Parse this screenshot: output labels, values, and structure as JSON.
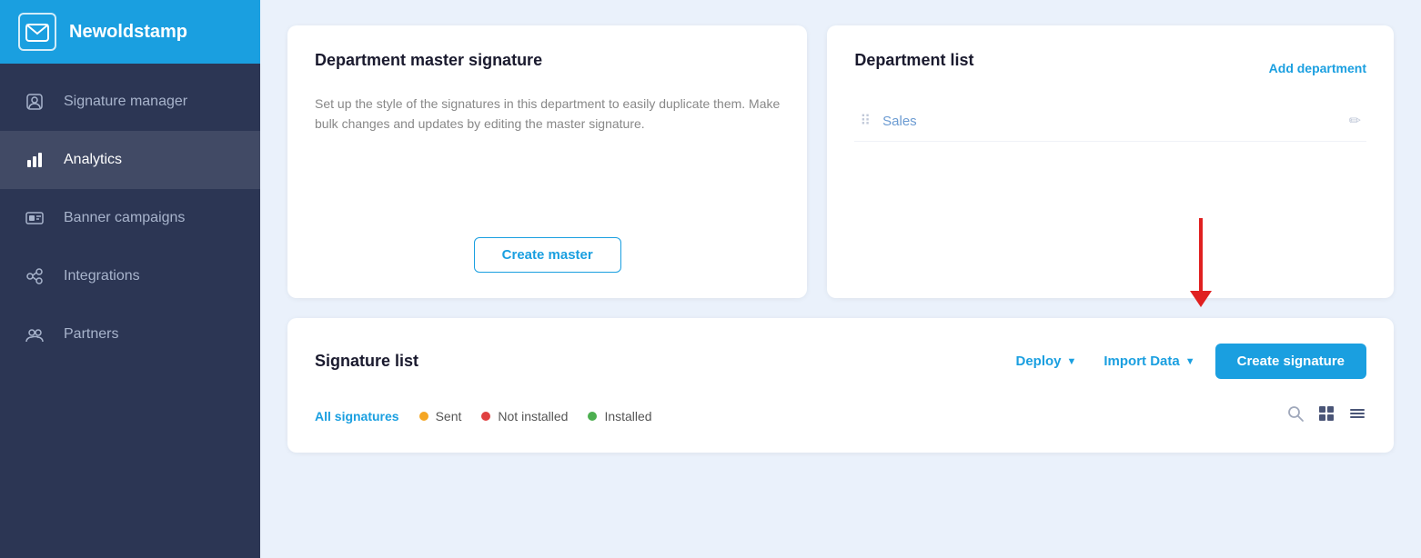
{
  "sidebar": {
    "brand": "Newoldstamp",
    "logo_icon": "✉",
    "items": [
      {
        "id": "signature-manager",
        "label": "Signature manager",
        "icon": "👤",
        "active": false
      },
      {
        "id": "analytics",
        "label": "Analytics",
        "icon": "📊",
        "active": true
      },
      {
        "id": "banner-campaigns",
        "label": "Banner campaigns",
        "icon": "🖼",
        "active": false
      },
      {
        "id": "integrations",
        "label": "Integrations",
        "icon": "🔗",
        "active": false
      },
      {
        "id": "partners",
        "label": "Partners",
        "icon": "🤝",
        "active": false
      }
    ]
  },
  "dept_master": {
    "title": "Department master signature",
    "description": "Set up the style of the signatures in this department to easily duplicate them. Make bulk changes and updates by editing the master signature.",
    "create_btn": "Create master"
  },
  "dept_list": {
    "title": "Department list",
    "add_dept_label": "Add department",
    "items": [
      {
        "name": "Sales"
      }
    ]
  },
  "signature_list": {
    "title": "Signature list",
    "deploy_label": "Deploy",
    "import_label": "Import Data",
    "create_btn": "Create signature",
    "filters": {
      "all": "All signatures",
      "sent": "Sent",
      "not_installed": "Not installed",
      "installed": "Installed"
    }
  },
  "icons": {
    "search": "🔍",
    "grid_view": "⊞",
    "list_view": "≡",
    "edit": "✏",
    "drag": "⠿",
    "chevron": "▼"
  }
}
